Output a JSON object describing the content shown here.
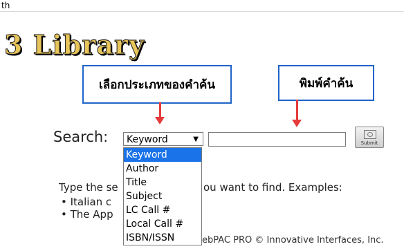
{
  "browser": {
    "tab_text": "th"
  },
  "logo": {
    "text": "3 Library"
  },
  "annotations": {
    "search_type_label": "เลือกประเภทของคำค้น",
    "search_term_label": "พิมพ์คำค้น"
  },
  "search": {
    "label": "Search:",
    "selected_type": "Keyword",
    "input_value": "",
    "submit_label": "Submit",
    "options": [
      "Keyword",
      "Author",
      "Title",
      "Subject",
      "LC Call #",
      "Local Call #",
      "ISBN/ISSN"
    ]
  },
  "help": {
    "intro_left": "Type the se",
    "intro_right": "ou want to find. Examples:",
    "bullet1": "• Italian c",
    "bullet2": "• The App"
  },
  "footer": {
    "text": "ebPAC PRO © Innovative Interfaces, Inc."
  },
  "colors": {
    "annotation_border": "#1f64c8",
    "arrow": "#e53b3b",
    "selected_option": "#1a73e8",
    "logo_gold": "#e8c55a"
  }
}
